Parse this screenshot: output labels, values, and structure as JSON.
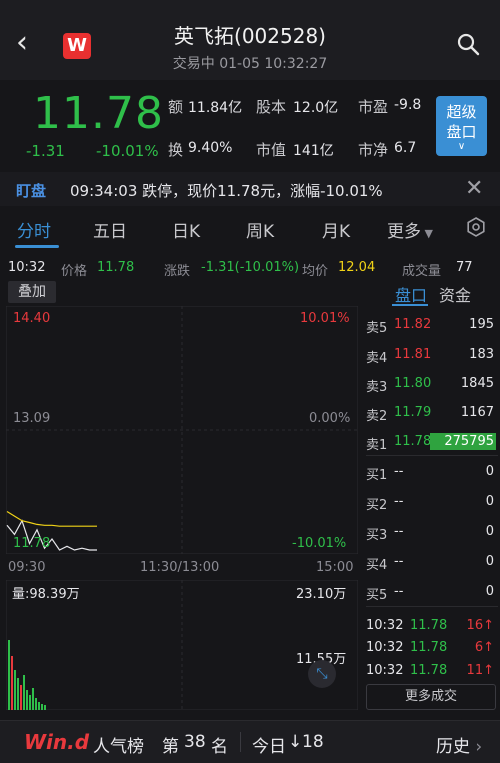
{
  "header": {
    "title": "英飞拓(002528)",
    "subtitle": "交易中 01-05 10:32:27",
    "back_icon": "chevron-left-icon",
    "logo_text": "W",
    "search_icon": "search-icon"
  },
  "quote": {
    "price": "11.78",
    "change": "-1.31",
    "change_pct": "-10.01%",
    "amount_label": "额",
    "amount": "11.84亿",
    "share_label": "股本",
    "share": "12.0亿",
    "pe_label": "市盈",
    "pe": "-9.8",
    "turnover_label": "换",
    "turnover": "9.40%",
    "mktcap_label": "市值",
    "mktcap": "141亿",
    "pb_label": "市净",
    "pb": "6.7",
    "super_button": "超级",
    "super_button2": "盘口"
  },
  "alert": {
    "tag": "盯盘",
    "text": "09:34:03 跌停，现价11.78元，涨幅-10.01%"
  },
  "tabs": [
    "分时",
    "五日",
    "日K",
    "周K",
    "月K",
    "更多"
  ],
  "info_row": {
    "time": "10:32",
    "price_label": "价格",
    "price": "11.78",
    "chg_label": "涨跌",
    "chg": "-1.31(-10.01%)",
    "avg_label": "均价",
    "avg": "12.04",
    "vol_label": "成交量",
    "vol": "77"
  },
  "chart": {
    "overlay_button": "叠加",
    "y_high": "14.40",
    "y_mid": "13.09",
    "y_low": "11.78",
    "pct_high": "10.01%",
    "pct_mid": "0.00%",
    "pct_low": "-10.01%",
    "x_start": "09:30",
    "x_mid": "11:30/13:00",
    "x_end": "15:00"
  },
  "chart_data": {
    "type": "line",
    "title": "",
    "xlabel": "",
    "ylabel": "",
    "ylim": [
      11.78,
      14.4
    ],
    "series": [
      {
        "values": [
          12.05,
          11.95,
          12.1,
          11.85,
          12.0,
          11.8,
          11.9,
          11.78,
          11.82,
          11.78,
          11.8,
          11.78,
          11.78
        ]
      },
      {
        "values": [
          12.2,
          12.15,
          12.1,
          12.08,
          12.06,
          12.05,
          12.05,
          12.04,
          12.04,
          12.04,
          12.04,
          12.04,
          12.04
        ]
      }
    ],
    "volume_max": "23.10万",
    "volume_mid": "11.55万"
  },
  "volume": {
    "label": "量:98.39万",
    "max": "23.10万",
    "mid": "11.55万"
  },
  "orderbook": {
    "tab_active": "盘口",
    "tab_other": "资金",
    "sells": [
      {
        "label": "卖5",
        "price": "11.82",
        "vol": "195"
      },
      {
        "label": "卖4",
        "price": "11.81",
        "vol": "183"
      },
      {
        "label": "卖3",
        "price": "11.80",
        "vol": "1845"
      },
      {
        "label": "卖2",
        "price": "11.79",
        "vol": "1167"
      },
      {
        "label": "卖1",
        "price": "11.78",
        "vol": "275795"
      }
    ],
    "buys": [
      {
        "label": "买1",
        "price": "--",
        "vol": "0"
      },
      {
        "label": "买2",
        "price": "--",
        "vol": "0"
      },
      {
        "label": "买3",
        "price": "--",
        "vol": "0"
      },
      {
        "label": "买4",
        "price": "--",
        "vol": "0"
      },
      {
        "label": "买5",
        "price": "--",
        "vol": "0"
      }
    ],
    "trades": [
      {
        "time": "10:32",
        "price": "11.78",
        "vol": "16"
      },
      {
        "time": "10:32",
        "price": "11.78",
        "vol": "6"
      },
      {
        "time": "10:32",
        "price": "11.78",
        "vol": "11"
      }
    ],
    "more_trades": "更多成交"
  },
  "bottom": {
    "logo": "Win.d",
    "rank_label": "人气榜",
    "rank_prefix": "第",
    "rank": "38",
    "rank_suffix": "名",
    "today_label": "今日",
    "today_val": "18",
    "history": "历史"
  },
  "colors": {
    "up": "#e8393d",
    "down": "#2fbf4a",
    "accent": "#3a8fd4",
    "avg": "#f1d317"
  }
}
